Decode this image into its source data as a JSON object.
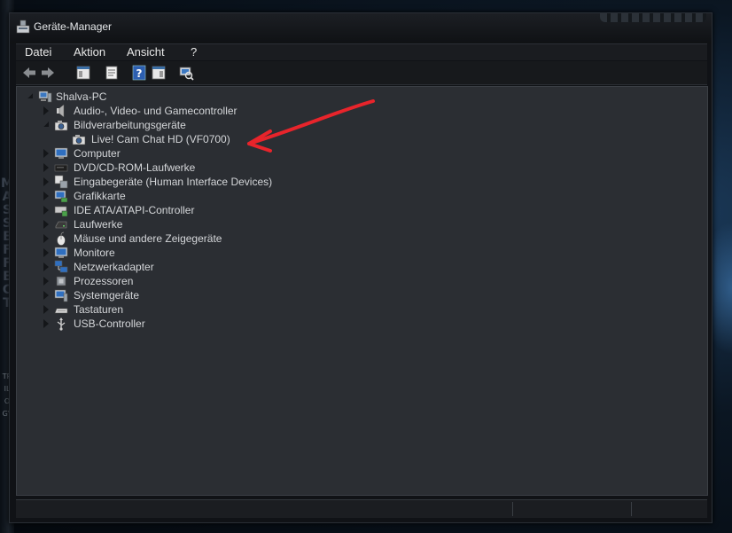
{
  "window": {
    "title": "Geräte-Manager"
  },
  "menu": [
    {
      "label": "Datei"
    },
    {
      "label": "Aktion"
    },
    {
      "label": "Ansicht"
    },
    {
      "label": "?"
    }
  ],
  "toolbar": [
    {
      "icon": "back-arrow-icon"
    },
    {
      "icon": "forward-arrow-icon"
    },
    {
      "icon": "console-tree-icon"
    },
    {
      "icon": "properties-icon"
    },
    {
      "icon": "help-icon"
    },
    {
      "icon": "action-pane-icon"
    },
    {
      "icon": "scan-hardware-icon"
    }
  ],
  "tree": {
    "root": {
      "label": "Shalva-PC",
      "icon": "computer-icon"
    },
    "categories": [
      {
        "label": "Audio-, Video- und Gamecontroller",
        "icon": "speaker-icon",
        "expanded": false
      },
      {
        "label": "Bildverarbeitungsgeräte",
        "icon": "camera-icon",
        "expanded": true,
        "children": [
          {
            "label": "Live! Cam Chat HD (VF0700)",
            "icon": "webcam-icon"
          }
        ]
      },
      {
        "label": "Computer",
        "icon": "monitor-icon",
        "expanded": false
      },
      {
        "label": "DVD/CD-ROM-Laufwerke",
        "icon": "disc-drive-icon",
        "expanded": false
      },
      {
        "label": "Eingabegeräte (Human Interface Devices)",
        "icon": "hid-icon",
        "expanded": false
      },
      {
        "label": "Grafikkarte",
        "icon": "display-adapter-icon",
        "expanded": false
      },
      {
        "label": "IDE ATA/ATAPI-Controller",
        "icon": "ide-controller-icon",
        "expanded": false
      },
      {
        "label": "Laufwerke",
        "icon": "hard-drive-icon",
        "expanded": false
      },
      {
        "label": "Mäuse und andere Zeigegeräte",
        "icon": "mouse-icon",
        "expanded": false
      },
      {
        "label": "Monitore",
        "icon": "monitor-icon",
        "expanded": false
      },
      {
        "label": "Netzwerkadapter",
        "icon": "network-adapter-icon",
        "expanded": false
      },
      {
        "label": "Prozessoren",
        "icon": "processor-icon",
        "expanded": false
      },
      {
        "label": "Systemgeräte",
        "icon": "system-device-icon",
        "expanded": false
      },
      {
        "label": "Tastaturen",
        "icon": "keyboard-icon",
        "expanded": false
      },
      {
        "label": "USB-Controller",
        "icon": "usb-icon",
        "expanded": false
      }
    ]
  },
  "background": {
    "side_text": "MASS EFFECT",
    "side_text_small": "TRILOGY"
  },
  "colors": {
    "annotation_arrow": "#e8242b",
    "panel_bg": "#2b2e33",
    "text": "#d4d6d9"
  }
}
